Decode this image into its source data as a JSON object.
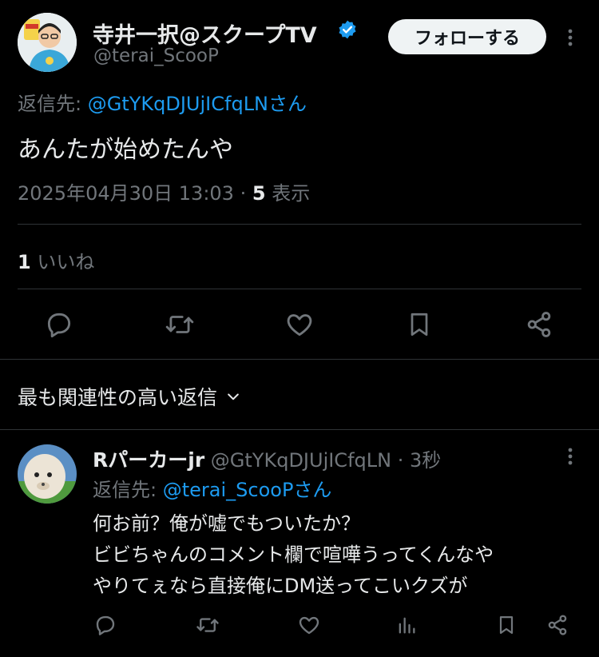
{
  "tweet": {
    "author_name": "寺井一択@スクープTV",
    "author_handle": "@terai_ScooP",
    "follow_label": "フォローする",
    "reply_to_prefix": "返信先:",
    "reply_to_handle": "@GtYKqDJUjICfqLNさん",
    "text": "あんたが始めたんや",
    "timestamp": "2025年04月30日 13:03",
    "separator": "·",
    "view_count": "5",
    "view_label": "表示",
    "like_count": "1",
    "like_label": "いいね"
  },
  "replies_sort": {
    "label": "最も関連性の高い返信"
  },
  "reply": {
    "author_name": "Rパーカーjr",
    "author_handle": "@GtYKqDJUjICfqLN",
    "time": "· 3秒",
    "reply_to_prefix": "返信先:",
    "reply_to_handle": "@terai_ScooPさん",
    "lines": [
      "何お前？俺が嘘でもついたか？",
      "ビビちゃんのコメント欄で喧嘩うってくんなや",
      "やりてぇなら直接俺にDM送ってこいクズが"
    ]
  },
  "colors": {
    "background": "#000000",
    "text": "#e7e9ea",
    "secondary": "#71767b",
    "accent": "#1d9bf0",
    "divider": "#2f3336"
  },
  "icons": [
    "verified-badge-icon",
    "more-icon",
    "reply-icon",
    "retweet-icon",
    "like-icon",
    "bookmark-icon",
    "share-icon",
    "chevron-down-icon",
    "analytics-icon"
  ]
}
